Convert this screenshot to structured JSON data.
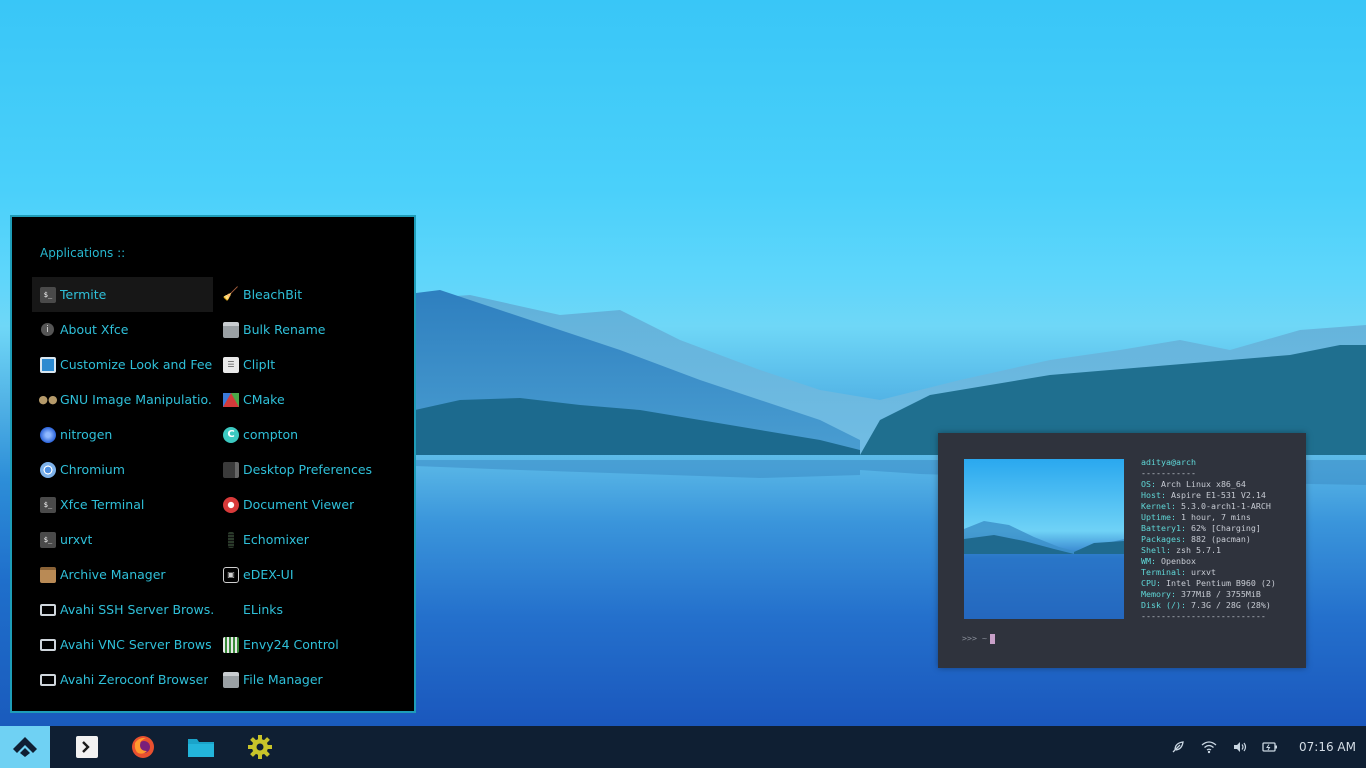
{
  "menu": {
    "title": "Applications ::",
    "left_items": [
      {
        "label": "Termite",
        "icon": "terminal-icon"
      },
      {
        "label": "About Xfce",
        "icon": "info-icon"
      },
      {
        "label": "Customize Look and Feel",
        "icon": "appearance-icon"
      },
      {
        "label": "GNU Image Manipulatio...",
        "icon": "gimp-icon"
      },
      {
        "label": "nitrogen",
        "icon": "nitrogen-icon"
      },
      {
        "label": "Chromium",
        "icon": "chromium-icon"
      },
      {
        "label": "Xfce Terminal",
        "icon": "terminal-icon"
      },
      {
        "label": "urxvt",
        "icon": "terminal-icon"
      },
      {
        "label": "Archive Manager",
        "icon": "archive-icon"
      },
      {
        "label": "Avahi SSH Server Brows...",
        "icon": "network-icon"
      },
      {
        "label": "Avahi VNC Server Brows...",
        "icon": "network-icon"
      },
      {
        "label": "Avahi Zeroconf Browser",
        "icon": "network-icon"
      }
    ],
    "right_items": [
      {
        "label": "BleachBit",
        "icon": "broom-icon"
      },
      {
        "label": "Bulk Rename",
        "icon": "rename-icon"
      },
      {
        "label": "ClipIt",
        "icon": "clipboard-icon"
      },
      {
        "label": "CMake",
        "icon": "cmake-icon"
      },
      {
        "label": "compton",
        "icon": "compton-icon"
      },
      {
        "label": "Desktop Preferences",
        "icon": "desktop-prefs-icon"
      },
      {
        "label": "Document Viewer",
        "icon": "document-viewer-icon"
      },
      {
        "label": "Echomixer",
        "icon": "mixer-icon"
      },
      {
        "label": "eDEX-UI",
        "icon": "edex-icon"
      },
      {
        "label": "ELinks",
        "icon": "elinks-icon"
      },
      {
        "label": "Envy24 Control",
        "icon": "envy24-icon"
      },
      {
        "label": "File Manager",
        "icon": "file-manager-icon"
      }
    ]
  },
  "terminal": {
    "user_host": "aditya@arch",
    "underline": "-----------",
    "info": [
      {
        "key": "OS",
        "value": "Arch Linux x86_64"
      },
      {
        "key": "Host",
        "value": "Aspire E1-531 V2.14"
      },
      {
        "key": "Kernel",
        "value": "5.3.0-arch1-1-ARCH"
      },
      {
        "key": "Uptime",
        "value": "1 hour, 7 mins"
      },
      {
        "key": "Battery1",
        "value": "62% [Charging]"
      },
      {
        "key": "Packages",
        "value": "882 (pacman)"
      },
      {
        "key": "Shell",
        "value": "zsh 5.7.1"
      },
      {
        "key": "WM",
        "value": "Openbox"
      },
      {
        "key": "Terminal",
        "value": "urxvt"
      },
      {
        "key": "CPU",
        "value": "Intel Pentium B960 (2)"
      },
      {
        "key": "Memory",
        "value": "377MiB / 3755MiB"
      },
      {
        "key": "Disk (/)",
        "value": "7.3G / 28G (28%)"
      }
    ],
    "bottom_rule": "-------------------------",
    "prompt": ">>>  ~"
  },
  "taskbar": {
    "clock": "07:16 AM",
    "apps": [
      "terminal-icon",
      "firefox-icon",
      "folder-icon",
      "settings-gear-icon"
    ],
    "tray": [
      "feather-icon",
      "wifi-icon",
      "volume-icon",
      "battery-icon"
    ]
  },
  "colors": {
    "accent": "#2fc0d9",
    "menu_bg": "#000000",
    "taskbar_bg": "#0f1f33",
    "start_bg": "#6fd1f3",
    "terminal_bg": "#2f333d"
  }
}
